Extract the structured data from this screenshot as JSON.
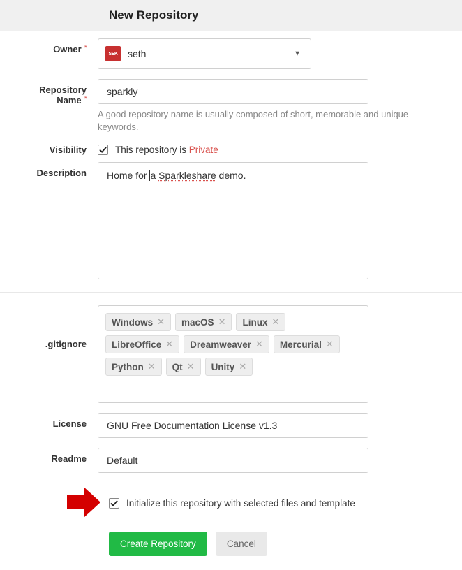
{
  "page_title": "New Repository",
  "owner": {
    "label": "Owner",
    "required": true,
    "avatar_text": "SEK",
    "value": "seth"
  },
  "repo_name": {
    "label": "Repository Name",
    "required": true,
    "value": "sparkly",
    "hint": "A good repository name is usually composed of short, memorable and unique keywords."
  },
  "visibility": {
    "label": "Visibility",
    "checked": true,
    "text_prefix": "This repository is ",
    "text_private": "Private"
  },
  "description": {
    "label": "Description",
    "value_parts": {
      "p1": "Home for ",
      "p2": "a",
      "p3": " ",
      "p4": "Sparkleshare",
      "p5": " demo."
    }
  },
  "gitignore": {
    "label": ".gitignore",
    "tags": [
      "Windows",
      "macOS",
      "Linux",
      "LibreOffice",
      "Dreamweaver",
      "Mercurial",
      "Python",
      "Qt",
      "Unity"
    ]
  },
  "license": {
    "label": "License",
    "value": "GNU Free Documentation License v1.3"
  },
  "readme": {
    "label": "Readme",
    "value": "Default"
  },
  "init": {
    "checked": true,
    "label": "Initialize this repository with selected files and template"
  },
  "buttons": {
    "create": "Create Repository",
    "cancel": "Cancel"
  },
  "colors": {
    "accent_green": "#21ba45",
    "danger_red": "#d9534f",
    "avatar_bg": "#c73030"
  }
}
